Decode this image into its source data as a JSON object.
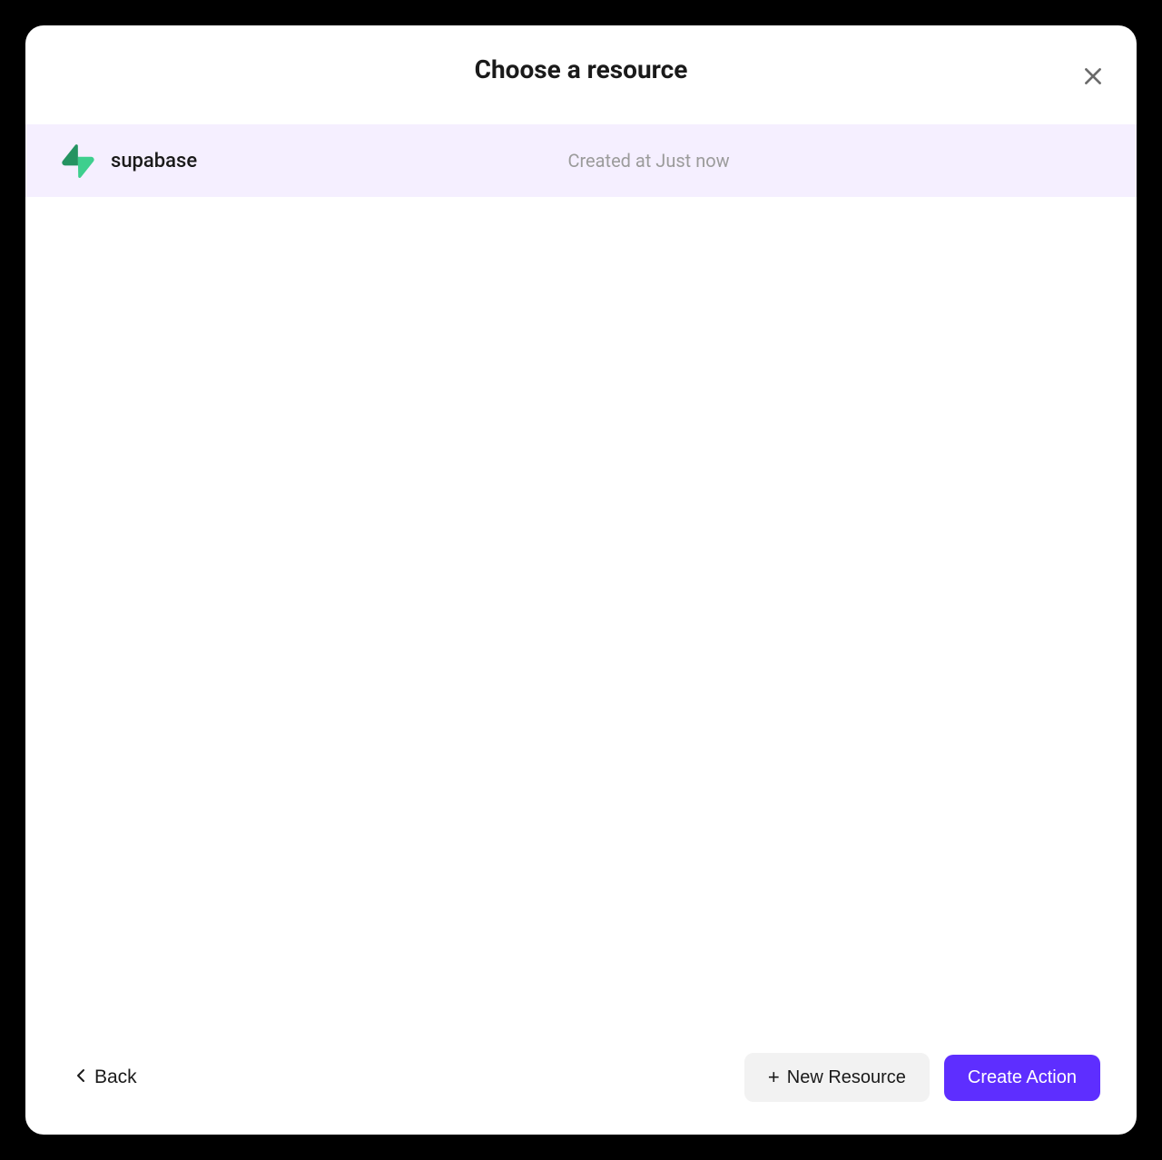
{
  "modal": {
    "title": "Choose a resource"
  },
  "resources": [
    {
      "name": "supabase",
      "icon": "supabase-icon",
      "meta": "Created at Just now"
    }
  ],
  "footer": {
    "back_label": "Back",
    "new_resource_label": "New Resource",
    "create_action_label": "Create Action"
  },
  "colors": {
    "accent": "#5e2eff",
    "selected_bg": "#f5efff",
    "supabase_green": "#3ecf8e"
  }
}
